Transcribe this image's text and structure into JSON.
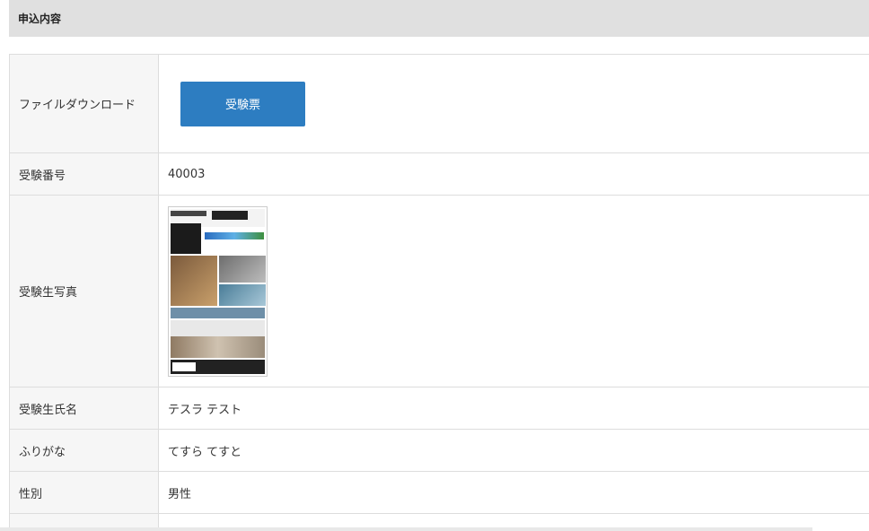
{
  "section": {
    "title": "申込内容"
  },
  "rows": {
    "download": {
      "label": "ファイルダウンロード",
      "button_label": "受験票"
    },
    "exam_number": {
      "label": "受験番号",
      "value": "40003"
    },
    "photo": {
      "label": "受験生写真"
    },
    "name": {
      "label": "受験生氏名",
      "value": "テスラ テスト"
    },
    "kana": {
      "label": "ふりがな",
      "value": "てすら てすと"
    },
    "gender": {
      "label": "性別",
      "value": "男性"
    }
  },
  "colors": {
    "button": "#2d7dc1",
    "header_bg": "#e0e0e0",
    "label_bg": "#f6f6f6",
    "border": "#dddddd"
  }
}
